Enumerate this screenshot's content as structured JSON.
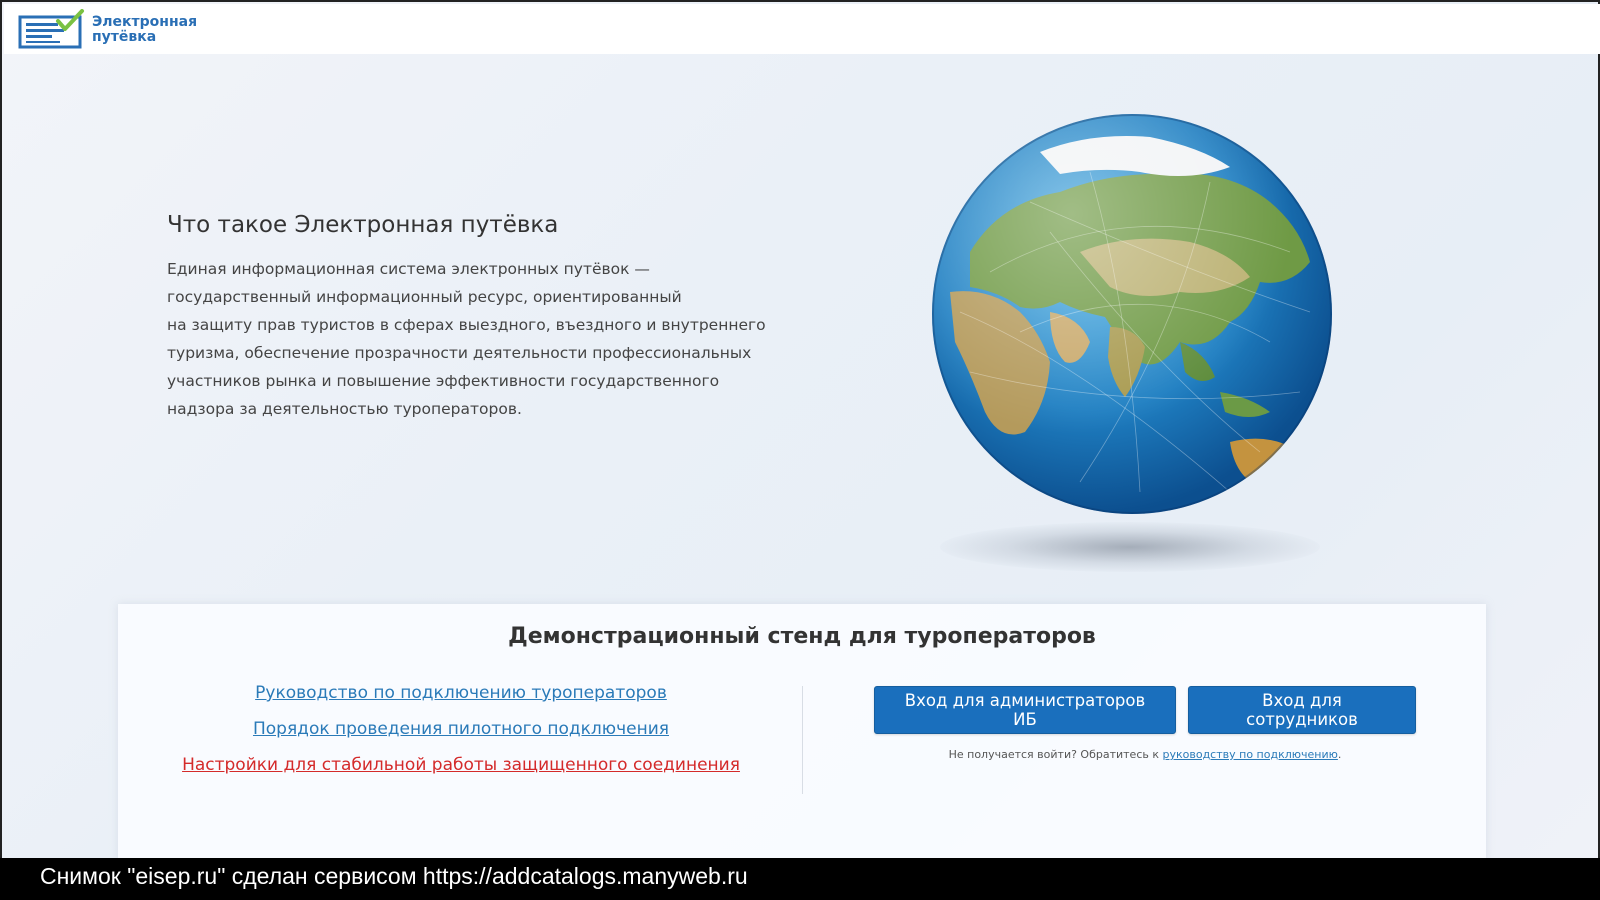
{
  "header": {
    "logo_line1": "Электронная",
    "logo_line2": "путёвка"
  },
  "hero": {
    "title": "Что такое Электронная путёвка",
    "description_lines": [
      "Единая информационная система электронных путёвок —",
      "государственный информационный ресурс, ориентированный",
      "на защиту прав туристов в сферах выездного, въездного и внутреннего",
      "туризма, обеспечение прозрачности деятельности профессиональных",
      "участников рынка и повышение эффективности государственного",
      "надзора за деятельностью туроператоров."
    ],
    "globe_icon": "earth-globe"
  },
  "demo": {
    "title": "Демонстрационный стенд для туроператоров",
    "links": {
      "guide": "Руководство по подключению туроператоров",
      "pilot": "Порядок проведения пилотного подключения",
      "settings": "Настройки для стабильной работы защищенного соединения"
    },
    "buttons": {
      "admin": "Вход для администраторов ИБ",
      "staff": "Вход для сотрудников"
    },
    "help_prefix": "Не получается войти? Обратитесь к ",
    "help_link": "руководству по подключению",
    "help_suffix": "."
  },
  "footer": {
    "text": "Снимок \"eisep.ru\" сделан сервисом https://addcatalogs.manyweb.ru"
  },
  "colors": {
    "brand_blue": "#1a6fbd",
    "link_blue": "#2a7ab8",
    "link_red": "#d42a2a",
    "logo_green": "#7ac142"
  }
}
